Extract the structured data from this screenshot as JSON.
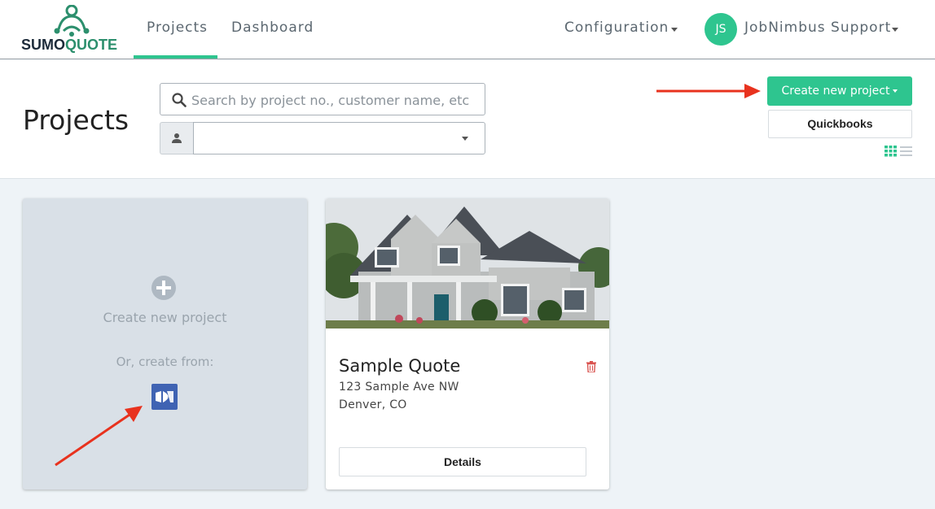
{
  "brand": {
    "logo_part1": "SUMO",
    "logo_part2": "QUOTE",
    "accent_color": "#2ec58f"
  },
  "nav": {
    "projects_label": "Projects",
    "dashboard_label": "Dashboard",
    "configuration_label": "Configuration",
    "user_initials": "JS",
    "user_name": "JobNimbus Support"
  },
  "header": {
    "title": "Projects",
    "search_placeholder": "Search by project no., customer name, etc",
    "user_filter_value": "",
    "create_button_label": "Create new project",
    "quickbooks_button_label": "Quickbooks"
  },
  "new_project_card": {
    "title": "Create new project",
    "or_label": "Or, create from:",
    "source_icon": "jobnimbus-icon"
  },
  "projects": [
    {
      "title": "Sample Quote",
      "address_line1": "123 Sample Ave NW",
      "address_line2": "Denver, CO",
      "details_label": "Details"
    }
  ],
  "colors": {
    "delete_icon": "#d9534f",
    "annotation_arrow": "#e8321e",
    "jobnimbus_blue": "#3f63b3"
  }
}
